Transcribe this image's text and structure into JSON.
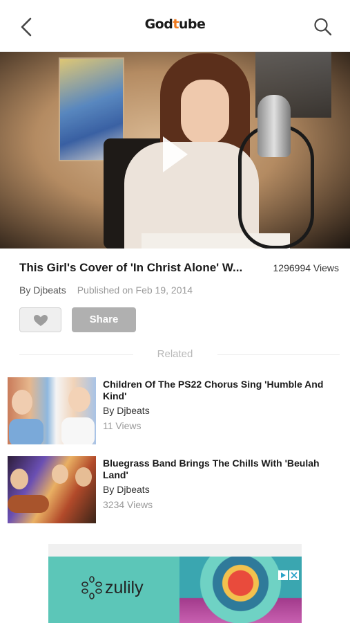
{
  "header": {
    "logo_prefix": "God",
    "logo_t": "t",
    "logo_suffix": "ube"
  },
  "video": {
    "title": "This Girl's Cover of 'In Christ Alone' W...",
    "views": "1296994 Views",
    "author": "By Djbeats",
    "published": "Published on Feb 19, 2014"
  },
  "actions": {
    "share_label": "Share"
  },
  "related": {
    "label": "Related",
    "items": [
      {
        "title": "Children Of The PS22 Chorus Sing 'Humble And Kind'",
        "author": "By Djbeats",
        "views": "11 Views"
      },
      {
        "title": "Bluegrass Band Brings The Chills With 'Beulah Land'",
        "author": "By Djbeats",
        "views": "3234 Views"
      }
    ]
  },
  "ad": {
    "brand": "zulily"
  },
  "colors": {
    "accent": "#f07a1e",
    "share_button": "#b0b0b0",
    "ad_background": "#5cc6b8"
  },
  "icons": {
    "back": "chevron-left-icon",
    "search": "search-icon",
    "play": "play-icon",
    "like": "heart-icon",
    "ad_choices": "adchoices-icon",
    "ad_close": "close-icon"
  }
}
